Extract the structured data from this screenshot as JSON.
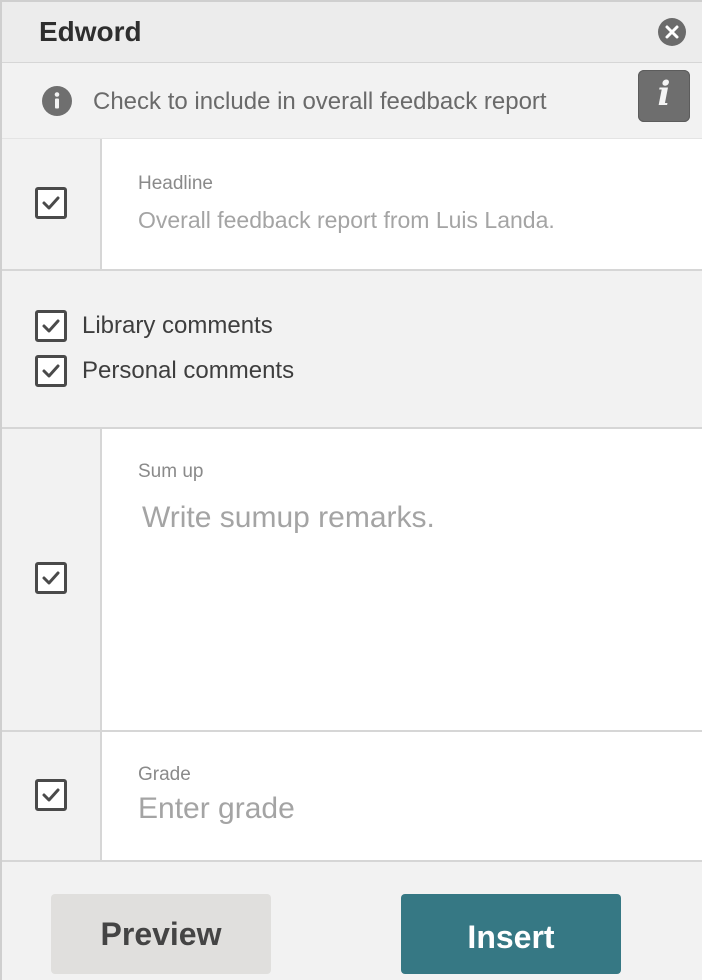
{
  "app": {
    "title": "Edword"
  },
  "info": {
    "text": "Check to include in overall feedback report",
    "help_glyph": "i"
  },
  "headline": {
    "checked": true,
    "label": "Headline",
    "value": "Overall feedback report from Luis Landa."
  },
  "comments": [
    {
      "label": "Library comments",
      "checked": true
    },
    {
      "label": "Personal comments",
      "checked": true
    }
  ],
  "sumup": {
    "checked": true,
    "label": "Sum up",
    "placeholder": "Write sumup remarks."
  },
  "grade": {
    "checked": true,
    "label": "Grade",
    "placeholder": "Enter grade"
  },
  "buttons": {
    "preview": "Preview",
    "insert": "Insert"
  },
  "colors": {
    "accent": "#367884",
    "panel_bg": "#f2f2f2",
    "secondary_button": "#e0dfdd"
  },
  "icons": [
    "close-icon",
    "info-icon",
    "help-icon",
    "checkmark-icon"
  ]
}
